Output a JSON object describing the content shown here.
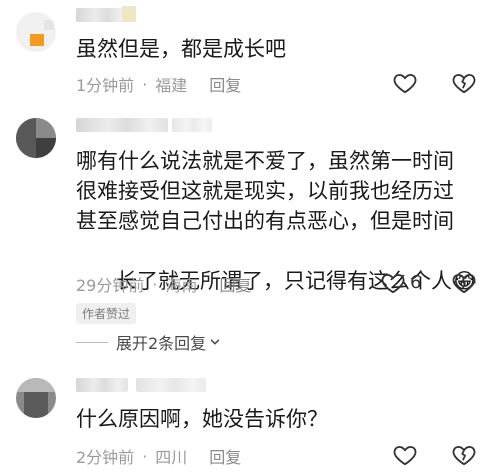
{
  "comments": [
    {
      "text": "虽然但是，都是成长吧",
      "time": "1分钟前",
      "location": "福建",
      "reply_label": "回复",
      "like_count": ""
    },
    {
      "lines": [
        "哪有什么说法就是不爱了，虽然第一时间",
        "很难接受但这就是现实，以前我也经历过",
        "甚至感觉自己付出的有点恶心，但是时间",
        "长了就无所谓了，只记得有这么个人"
      ],
      "emoji": "😂",
      "time": "29分钟前",
      "location": "海南",
      "reply_label": "回复",
      "like_count": "6",
      "badge": "作者赞过",
      "expand_label": "展开2条回复"
    },
    {
      "text": "什么原因啊，她没告诉你？",
      "time": "2分钟前",
      "location": "四川",
      "reply_label": "回复",
      "like_count": ""
    }
  ],
  "colors": {
    "text": "#1a1a1a",
    "meta": "#9b9b9b",
    "accent_avatar": "#f39a1f"
  },
  "icons": [
    "heart-outline-icon",
    "broken-heart-icon",
    "chevron-down-icon"
  ]
}
